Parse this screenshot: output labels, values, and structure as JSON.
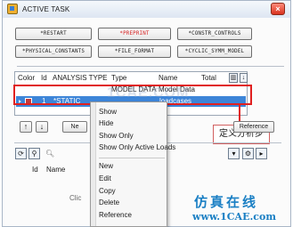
{
  "window": {
    "title": "ACTIVE TASK",
    "close_label": "×"
  },
  "command_buttons": {
    "row1": [
      "*RESTART",
      "*PREPRINT",
      "*CONSTR_CONTROLS"
    ],
    "row2": [
      "*PHYSICAL_CONSTANTS",
      "*FILE_FORMAT",
      "*CYCLIC_SYMM_MODEL"
    ]
  },
  "list": {
    "headers": [
      "Color",
      "Id",
      "ANALYSIS TYPE",
      "Type",
      "Name",
      "Total"
    ],
    "subheaders": [
      "MODEL DATA",
      "Model Data"
    ],
    "row": {
      "id": "1",
      "analysis_type": "*STATIC",
      "name": "loadcases"
    }
  },
  "context_menu": {
    "items": [
      "Show",
      "Hide",
      "Show Only",
      "Show Only Active Loads",
      "New",
      "Edit",
      "Copy",
      "Delete",
      "Reference"
    ]
  },
  "lower_toolbar": {
    "up": "↑",
    "down": "↓",
    "new": "Ne",
    "reference": "Reference"
  },
  "lower_panel": {
    "headers": [
      "Id",
      "Name"
    ],
    "placeholder": "Clic"
  },
  "annotation": {
    "callout": "定义分析步"
  },
  "watermark": {
    "line1": "仿真在线",
    "line2": "www.1CAE.com",
    "faint": "1CAE.COM"
  },
  "colors": {
    "selection": "#3d85d8",
    "highlight_box": "#e02020",
    "prepint_text": "#d42020",
    "watermark": "#1a7fc4",
    "row_swatch": "#c23b3b"
  }
}
